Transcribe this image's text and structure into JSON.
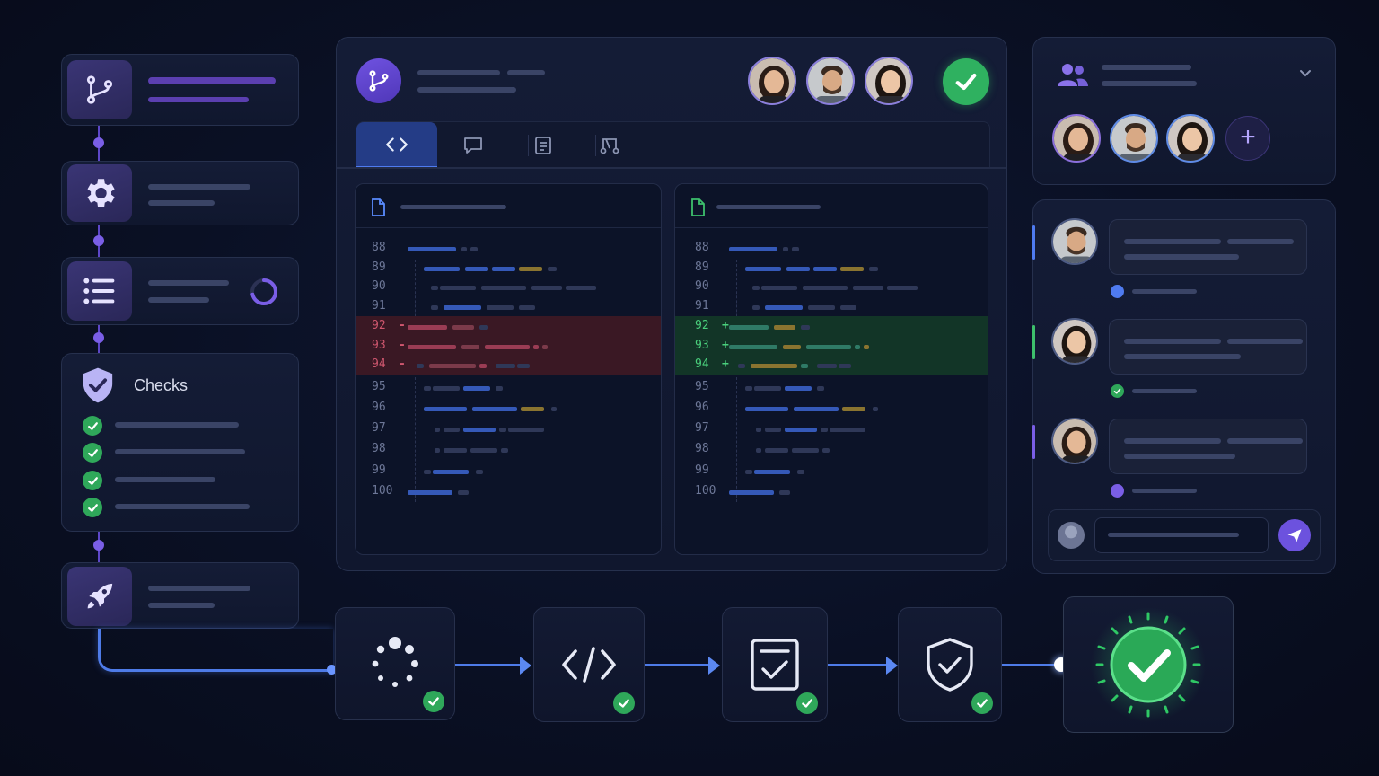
{
  "pipeline_sidebar": {
    "checks_title": "Checks",
    "checks_count": 4
  },
  "code_review": {
    "tabs": [
      "code-icon",
      "comment-icon",
      "document-icon",
      "merge-icon"
    ],
    "old_lines_top": [
      "88",
      "89",
      "90",
      "91"
    ],
    "old_lines_removed": [
      "92",
      "93",
      "94"
    ],
    "old_lines_bottom": [
      "95",
      "96",
      "97",
      "98",
      "99",
      "100"
    ],
    "new_lines_top": [
      "88",
      "89",
      "90",
      "91"
    ],
    "new_lines_added": [
      "92",
      "93",
      "94"
    ],
    "new_lines_bottom": [
      "95",
      "96",
      "97",
      "98",
      "99",
      "100"
    ],
    "removed_marker": "-",
    "added_marker": "+",
    "status": "approved"
  },
  "collaborators": {
    "add_label": "+"
  },
  "pipeline_steps": [
    "loading-icon",
    "code-icon",
    "checklist-icon",
    "shield-icon",
    "success-icon"
  ],
  "colors": {
    "accent": "#6b4fd8",
    "success": "#2fa85a",
    "removed_bg": "#3a1824",
    "added_bg": "#123527",
    "connector": "#4e7be8"
  }
}
